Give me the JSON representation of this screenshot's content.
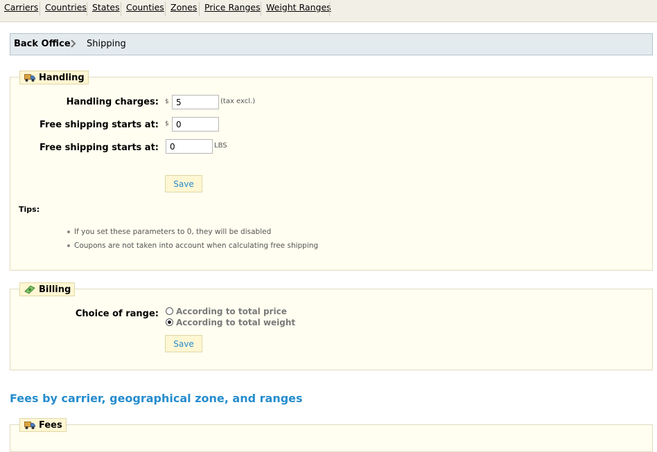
{
  "nav": [
    "Carriers",
    "Countries",
    "States",
    "Counties",
    "Zones",
    "Price Ranges",
    "Weight Ranges"
  ],
  "breadcrumb": {
    "root": "Back Office",
    "current": "Shipping"
  },
  "handling": {
    "legend": "Handling",
    "charges_label": "Handling charges:",
    "charges_currency": "$",
    "charges_value": "5",
    "charges_unit": "(tax excl.)",
    "free_price_label": "Free shipping starts at:",
    "free_price_currency": "$",
    "free_price_value": "0",
    "free_weight_label": "Free shipping starts at:",
    "free_weight_value": "0",
    "free_weight_unit": "LBS",
    "save_label": "Save",
    "tips_title": "Tips:",
    "tips": [
      "If you set these parameters to 0, they will be disabled",
      "Coupons are not taken into account when calculating free shipping"
    ]
  },
  "billing": {
    "legend": "Billing",
    "choice_label": "Choice of range:",
    "options": [
      "According to total price",
      "According to total weight"
    ],
    "selected_index": 1,
    "save_label": "Save"
  },
  "fees_section": {
    "title": "Fees by carrier, geographical zone, and ranges",
    "legend": "Fees"
  },
  "icons": {
    "truck": "truck-icon",
    "money": "money-icon",
    "chevron": "chevron-right-icon"
  }
}
